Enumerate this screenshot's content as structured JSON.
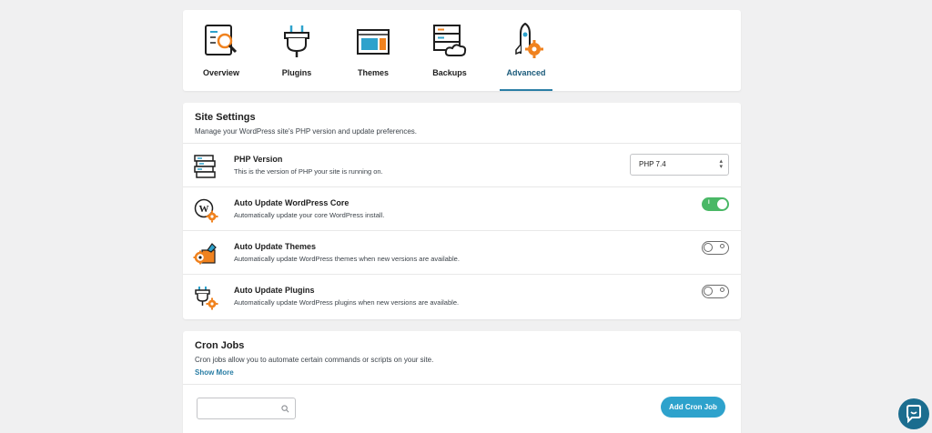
{
  "tabs": [
    {
      "label": "Overview",
      "icon": "overview-magnifier-icon",
      "active": false
    },
    {
      "label": "Plugins",
      "icon": "plugin-plug-icon",
      "active": false
    },
    {
      "label": "Themes",
      "icon": "themes-window-icon",
      "active": false
    },
    {
      "label": "Backups",
      "icon": "backups-server-cloud-icon",
      "active": false
    },
    {
      "label": "Advanced",
      "icon": "advanced-rocket-gear-icon",
      "active": true
    }
  ],
  "site_settings": {
    "title": "Site Settings",
    "description": "Manage your WordPress site's PHP version and update preferences.",
    "rows": [
      {
        "title": "PHP Version",
        "description": "This is the version of PHP your site is running on.",
        "control": "select",
        "value": "PHP 7.4",
        "icon": "php-server-stack-icon"
      },
      {
        "title": "Auto Update WordPress Core",
        "description": "Automatically update your core WordPress install.",
        "control": "toggle",
        "on": true,
        "icon": "wordpress-gear-icon"
      },
      {
        "title": "Auto Update Themes",
        "description": "Automatically update WordPress themes when new versions are available.",
        "control": "toggle",
        "on": false,
        "icon": "themes-gear-icon"
      },
      {
        "title": "Auto Update Plugins",
        "description": "Automatically update WordPress plugins when new versions are available.",
        "control": "toggle",
        "on": false,
        "icon": "plugins-gear-icon"
      }
    ]
  },
  "cron": {
    "title": "Cron Jobs",
    "description": "Cron jobs allow you to automate certain commands or scripts on your site.",
    "show_more": "Show More",
    "search_placeholder": "",
    "add_button": "Add Cron Job"
  },
  "colors": {
    "accent": "#2ea2cc",
    "active_tab": "#2a7ea5",
    "toggle_on": "#4ab866",
    "icon_orange": "#f0821e",
    "chat": "#1b6d8f"
  }
}
